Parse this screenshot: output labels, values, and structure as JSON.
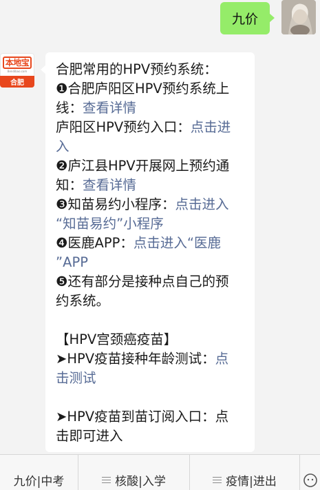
{
  "user_message": {
    "text": "九价"
  },
  "bot": {
    "avatar": {
      "logo_text": "本地宝",
      "logo_url": "Bendibao.com",
      "city": "合肥"
    },
    "message_lines": [
      [
        {
          "t": "合肥常用的HPV预约系统："
        }
      ],
      [
        {
          "t": "❶合肥庐阳区HPV预约系统上"
        }
      ],
      [
        {
          "t": "线："
        },
        {
          "t": "查看详情",
          "link": true
        }
      ],
      [
        {
          "t": "庐阳区HPV预约入口："
        },
        {
          "t": "点击进",
          "link": true
        }
      ],
      [
        {
          "t": "入",
          "link": true
        }
      ],
      [
        {
          "t": "❷庐江县HPV开展网上预约通"
        }
      ],
      [
        {
          "t": "知："
        },
        {
          "t": "查看详情",
          "link": true
        }
      ],
      [
        {
          "t": "❸知苗易约小程序："
        },
        {
          "t": "点击进入",
          "link": true
        }
      ],
      [
        {
          "t": "“知苗易约”小程序",
          "link": true
        }
      ],
      [
        {
          "t": "❹医鹿APP："
        },
        {
          "t": "点击进入“医鹿",
          "link": true
        }
      ],
      [
        {
          "t": "”APP",
          "link": true
        }
      ],
      [
        {
          "t": "❺还有部分是接种点自己的预"
        }
      ],
      [
        {
          "t": "约系统。"
        }
      ],
      [],
      [
        {
          "t": "【HPV宫颈癌疫苗】"
        }
      ],
      [
        {
          "t": "➤HPV疫苗接种年龄测试："
        },
        {
          "t": "点",
          "link": true
        }
      ],
      [
        {
          "t": "击测试",
          "link": true
        }
      ],
      [],
      [
        {
          "t": "➤HPV疫苗到苗订阅入口：点"
        }
      ],
      [
        {
          "t": "击即可进入"
        }
      ]
    ]
  },
  "menu": {
    "items": [
      "九价|中考",
      "核酸|入学",
      "疫情|进出"
    ]
  }
}
